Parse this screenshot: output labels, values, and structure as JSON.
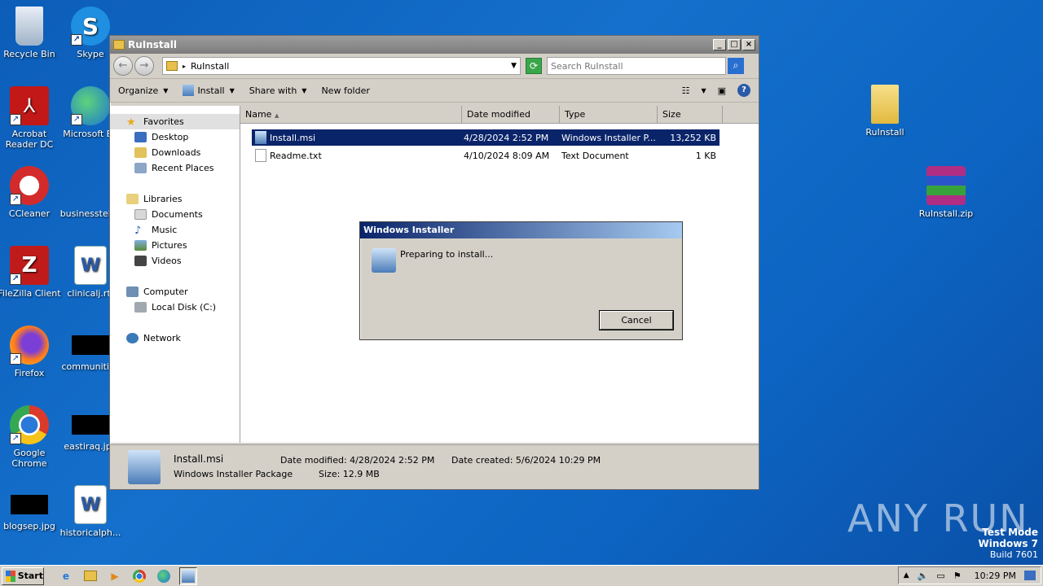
{
  "desktop": {
    "icons": [
      {
        "label": "Recycle Bin",
        "icon": "recycle-bin-icon"
      },
      {
        "label": "Skype",
        "icon": "skype-icon"
      },
      {
        "label": "Acrobat Reader DC",
        "icon": "acrobat-icon"
      },
      {
        "label": "Microsoft Ed",
        "icon": "edge-icon"
      },
      {
        "label": "CCleaner",
        "icon": "ccleaner-icon"
      },
      {
        "label": "businessteles",
        "icon": "document-icon"
      },
      {
        "label": "FileZilla Client",
        "icon": "filezilla-icon"
      },
      {
        "label": "clinicalj.rtf",
        "icon": "word-icon"
      },
      {
        "label": "Firefox",
        "icon": "firefox-icon"
      },
      {
        "label": "communities",
        "icon": "image-thumb"
      },
      {
        "label": "Google Chrome",
        "icon": "chrome-icon"
      },
      {
        "label": "eastiraq.jpg",
        "icon": "image-thumb"
      },
      {
        "label": "blogsep.jpg",
        "icon": "image-thumb"
      },
      {
        "label": "historicalph...",
        "icon": "word-icon"
      },
      {
        "label": "RuInstall",
        "icon": "folder-icon"
      },
      {
        "label": "RuInstall.zip",
        "icon": "winrar-icon"
      }
    ]
  },
  "explorer": {
    "title": "RuInstall",
    "address": "RuInstall",
    "search_placeholder": "Search RuInstall",
    "toolbar": {
      "organize": "Organize",
      "install": "Install",
      "share_with": "Share with",
      "new_folder": "New folder"
    },
    "nav": {
      "favorites": "Favorites",
      "desktop": "Desktop",
      "downloads": "Downloads",
      "recent_places": "Recent Places",
      "libraries": "Libraries",
      "documents": "Documents",
      "music": "Music",
      "pictures": "Pictures",
      "videos": "Videos",
      "computer": "Computer",
      "local_disk": "Local Disk (C:)",
      "network": "Network"
    },
    "columns": {
      "name": "Name",
      "date_modified": "Date modified",
      "type": "Type",
      "size": "Size"
    },
    "files": [
      {
        "name": "Install.msi",
        "date": "4/28/2024 2:52 PM",
        "type": "Windows Installer P...",
        "size": "13,252 KB"
      },
      {
        "name": "Readme.txt",
        "date": "4/10/2024 8:09 AM",
        "type": "Text Document",
        "size": "1 KB"
      }
    ],
    "details": {
      "name": "Install.msi",
      "type": "Windows Installer Package",
      "date_modified": "Date modified: 4/28/2024 2:52 PM",
      "size": "Size: 12.9 MB",
      "date_created": "Date created: 5/6/2024 10:29 PM"
    }
  },
  "dialog": {
    "title": "Windows Installer",
    "message": "Preparing to install...",
    "cancel": "Cancel"
  },
  "taskbar": {
    "start": "Start",
    "time": "10:29 PM"
  },
  "watermark": {
    "line1": "Test Mode",
    "line2": "Windows 7",
    "line3": "Build 7601",
    "brand": "ANY RUN"
  }
}
